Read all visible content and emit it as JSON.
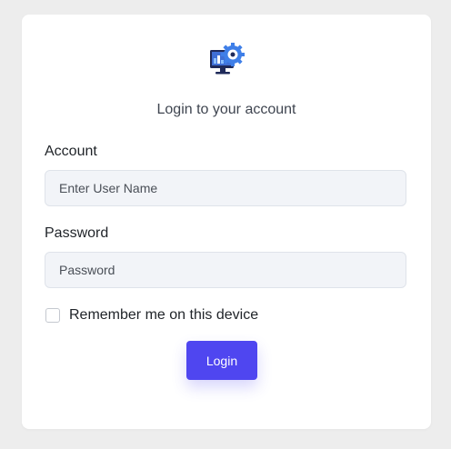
{
  "header": {
    "logo_icon": "computer-gear-icon",
    "subtitle": "Login to your account"
  },
  "form": {
    "account_label": "Account",
    "account_placeholder": "Enter User Name",
    "account_value": "",
    "password_label": "Password",
    "password_placeholder": "Password",
    "password_value": "",
    "remember_label": "Remember me on this device",
    "remember_checked": false,
    "login_label": "Login"
  },
  "colors": {
    "accent": "#4f46f0",
    "page_background": "#ededed",
    "card_background": "#ffffff",
    "input_background": "#f2f4f8"
  }
}
